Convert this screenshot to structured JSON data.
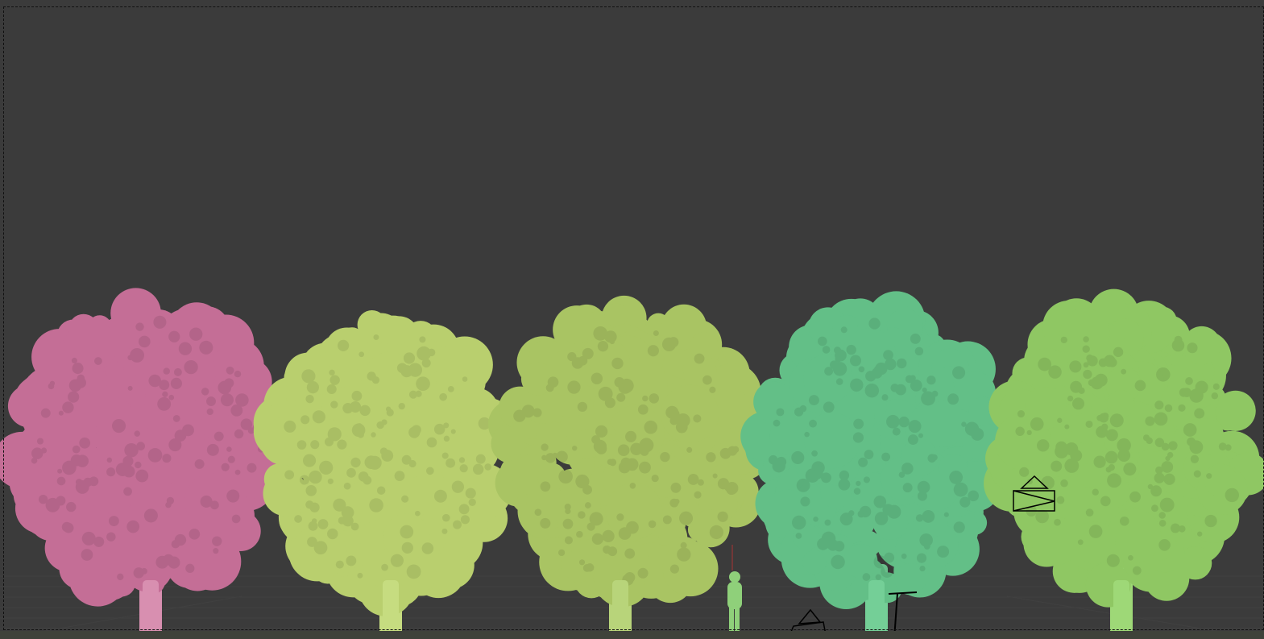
{
  "viewport": {
    "background": "#3b3b3b",
    "grid_color": "#444444"
  },
  "objects": [
    {
      "name": "tree-pink",
      "color": "#c46e96",
      "trunk": "#d88fb0"
    },
    {
      "name": "tree-yellow-green",
      "color": "#b9cf6e",
      "trunk": "#c6dc80"
    },
    {
      "name": "tree-olive-green",
      "color": "#a9c463",
      "trunk": "#b8d47a"
    },
    {
      "name": "tree-teal-green",
      "color": "#63bf87",
      "trunk": "#74cf97"
    },
    {
      "name": "tree-green",
      "color": "#8fc763",
      "trunk": "#9ed877"
    }
  ],
  "gizmos": {
    "human_figure_color": "#8fd07a",
    "camera_color": "#000000",
    "origin_color": "#e07a20"
  }
}
